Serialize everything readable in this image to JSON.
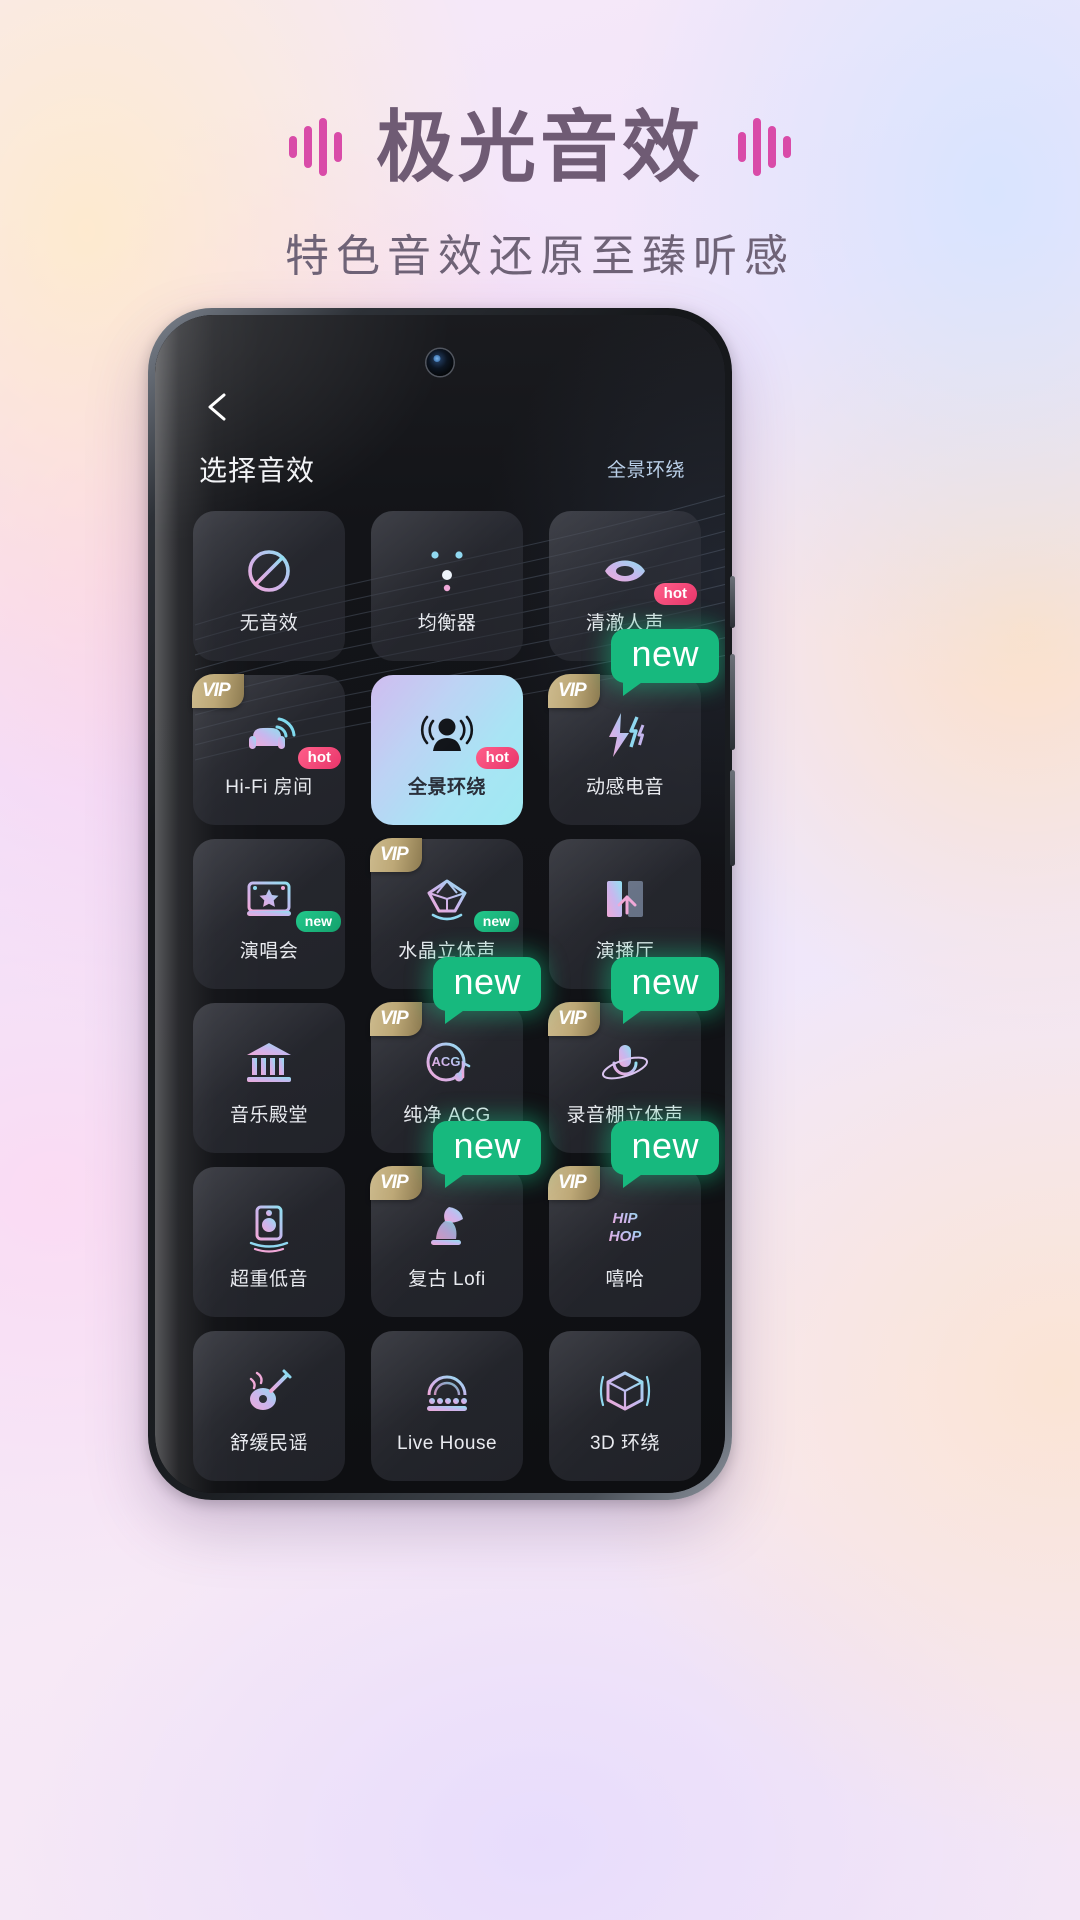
{
  "hero": {
    "title": "极光音效",
    "subtitle": "特色音效还原至臻听感",
    "wave_color": "#d94ba8",
    "title_color": "#6f5b74"
  },
  "phone": {
    "screen": {
      "back_icon": "chevron-left-icon",
      "title": "选择音效",
      "current_effect": "全景环绕",
      "current_effect_color": "#b9cfe8"
    }
  },
  "badges": {
    "vip_label": "VIP",
    "hot_label": "hot",
    "new_label": "new",
    "new_color": "#17b97e",
    "hot_color": "#e8356a",
    "vip_color": "#bda877"
  },
  "grid": {
    "rows": [
      [
        {
          "label": "无音效",
          "icon": "no-sound-prohibition-icon",
          "vip": false,
          "hot": false,
          "new_tag": false,
          "new_bubble": null,
          "selected": false
        },
        {
          "label": "均衡器",
          "icon": "equalizer-sliders-icon",
          "vip": false,
          "hot": false,
          "new_tag": false,
          "new_bubble": null,
          "selected": false
        },
        {
          "label": "清澈人声",
          "icon": "lips-vocal-icon",
          "vip": false,
          "hot": true,
          "new_tag": false,
          "new_bubble": null,
          "selected": false
        }
      ],
      [
        {
          "label": "Hi-Fi 房间",
          "icon": "armchair-hifi-icon",
          "vip": true,
          "hot": true,
          "new_tag": false,
          "new_bubble": null,
          "selected": false
        },
        {
          "label": "全景环绕",
          "icon": "person-surround-icon",
          "vip": false,
          "hot": true,
          "new_tag": false,
          "new_bubble": null,
          "selected": true
        },
        {
          "label": "动感电音",
          "icon": "lightning-electronic-icon",
          "vip": true,
          "hot": false,
          "new_tag": false,
          "new_bubble": "right",
          "selected": false
        }
      ],
      [
        {
          "label": "演唱会",
          "icon": "concert-stage-icon",
          "vip": false,
          "hot": false,
          "new_tag": true,
          "new_bubble": null,
          "selected": false
        },
        {
          "label": "水晶立体声",
          "icon": "crystal-diamond-icon",
          "vip": true,
          "hot": false,
          "new_tag": true,
          "new_bubble": null,
          "selected": false
        },
        {
          "label": "演播厅",
          "icon": "studio-hall-icon",
          "vip": false,
          "hot": false,
          "new_tag": false,
          "new_bubble": null,
          "selected": false
        }
      ],
      [
        {
          "label": "音乐殿堂",
          "icon": "music-hall-columns-icon",
          "vip": false,
          "hot": false,
          "new_tag": false,
          "new_bubble": null,
          "selected": false
        },
        {
          "label": "纯净 ACG",
          "icon": "acg-disc-icon",
          "vip": true,
          "hot": false,
          "new_tag": false,
          "new_bubble": "right",
          "selected": false
        },
        {
          "label": "录音棚立体声",
          "icon": "studio-mic-icon",
          "vip": true,
          "hot": false,
          "new_tag": false,
          "new_bubble": "right",
          "selected": false
        }
      ],
      [
        {
          "label": "超重低音",
          "icon": "subwoofer-speaker-icon",
          "vip": false,
          "hot": false,
          "new_tag": false,
          "new_bubble": null,
          "selected": false
        },
        {
          "label": "复古 Lofi",
          "icon": "gramophone-lofi-icon",
          "vip": true,
          "hot": false,
          "new_tag": false,
          "new_bubble": "right",
          "selected": false
        },
        {
          "label": "嘻哈",
          "icon": "hiphop-text-icon",
          "vip": true,
          "hot": false,
          "new_tag": false,
          "new_bubble": "right",
          "selected": false
        }
      ],
      [
        {
          "label": "舒缓民谣",
          "icon": "guitar-folk-icon",
          "vip": false,
          "hot": false,
          "new_tag": false,
          "new_bubble": null,
          "selected": false
        },
        {
          "label": "Live House",
          "icon": "live-house-crowd-icon",
          "vip": false,
          "hot": false,
          "new_tag": false,
          "new_bubble": null,
          "selected": false
        },
        {
          "label": "3D 环绕",
          "icon": "cube-3d-surround-icon",
          "vip": false,
          "hot": false,
          "new_tag": false,
          "new_bubble": null,
          "selected": false
        }
      ]
    ]
  }
}
